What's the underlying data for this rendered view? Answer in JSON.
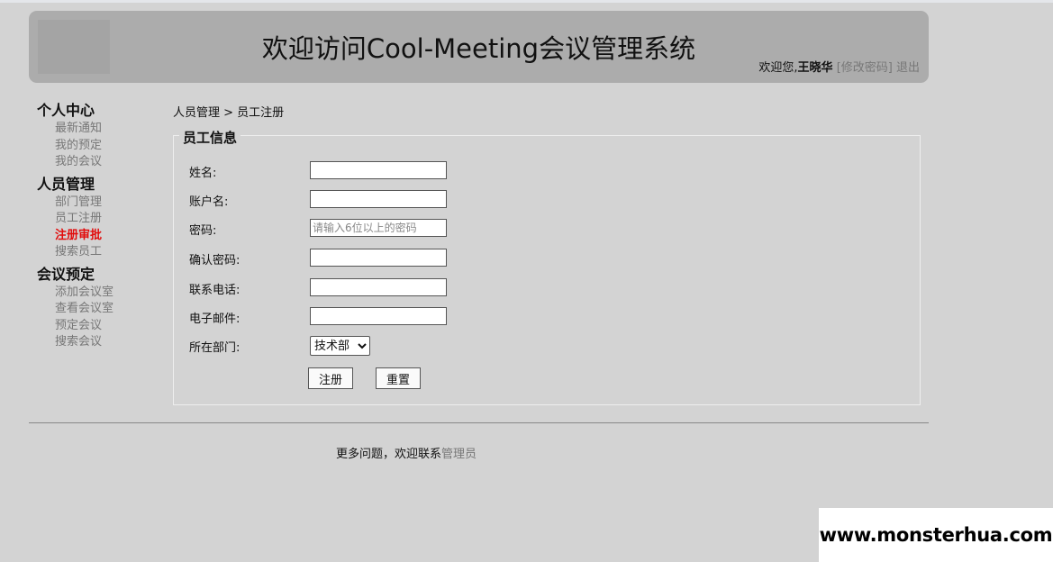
{
  "header": {
    "title": "欢迎访问Cool-Meeting会议管理系统",
    "welcome_text": "欢迎您,",
    "user_name": "王晓华",
    "change_password": "[修改密码]",
    "logout": "退出"
  },
  "sidebar": {
    "groups": [
      {
        "title": "个人中心",
        "items": [
          "最新通知",
          "我的预定",
          "我的会议"
        ]
      },
      {
        "title": "人员管理",
        "items": [
          "部门管理",
          "员工注册",
          "注册审批",
          "搜索员工"
        ]
      },
      {
        "title": "会议预定",
        "items": [
          "添加会议室",
          "查看会议室",
          "预定会议",
          "搜索会议"
        ]
      }
    ],
    "active_item": "注册审批"
  },
  "breadcrumb": "人员管理 > 员工注册",
  "form": {
    "legend": "员工信息",
    "fields": {
      "name": {
        "label": "姓名:",
        "value": "",
        "placeholder": ""
      },
      "account": {
        "label": "账户名:",
        "value": "",
        "placeholder": ""
      },
      "password": {
        "label": "密码:",
        "value": "",
        "placeholder": "请输入6位以上的密码"
      },
      "confirm": {
        "label": "确认密码:",
        "value": "",
        "placeholder": ""
      },
      "phone": {
        "label": "联系电话:",
        "value": "",
        "placeholder": ""
      },
      "email": {
        "label": "电子邮件:",
        "value": "",
        "placeholder": ""
      }
    },
    "department": {
      "label": "所在部门:",
      "selected": "技术部"
    },
    "submit_label": "注册",
    "reset_label": "重置"
  },
  "footer": {
    "text": "更多问题，欢迎联系",
    "link": "管理员"
  },
  "watermark": "www.monsterhua.com"
}
